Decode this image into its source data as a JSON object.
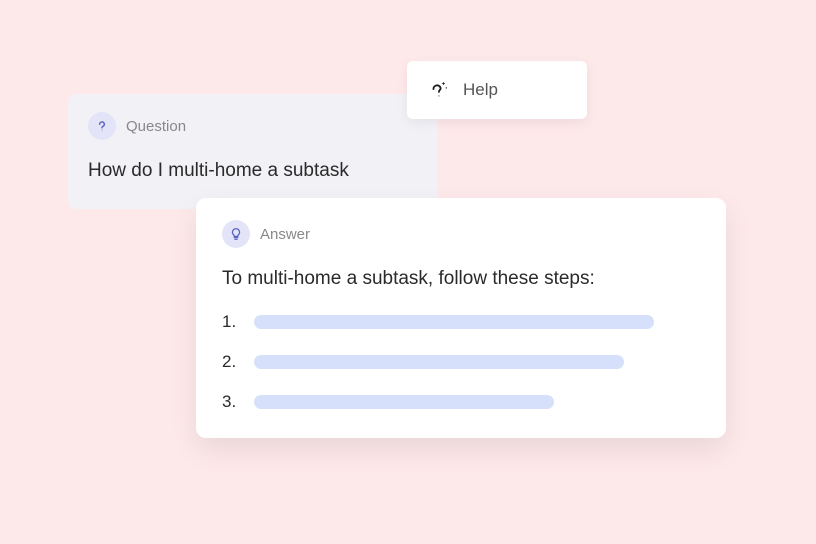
{
  "help_chip": {
    "label": "Help"
  },
  "question": {
    "header_label": "Question",
    "text": "How do I multi-home a subtask"
  },
  "answer": {
    "header_label": "Answer",
    "intro": "To multi-home a subtask, follow these steps:",
    "steps": {
      "n1": "1.",
      "n2": "2.",
      "n3": "3."
    }
  }
}
